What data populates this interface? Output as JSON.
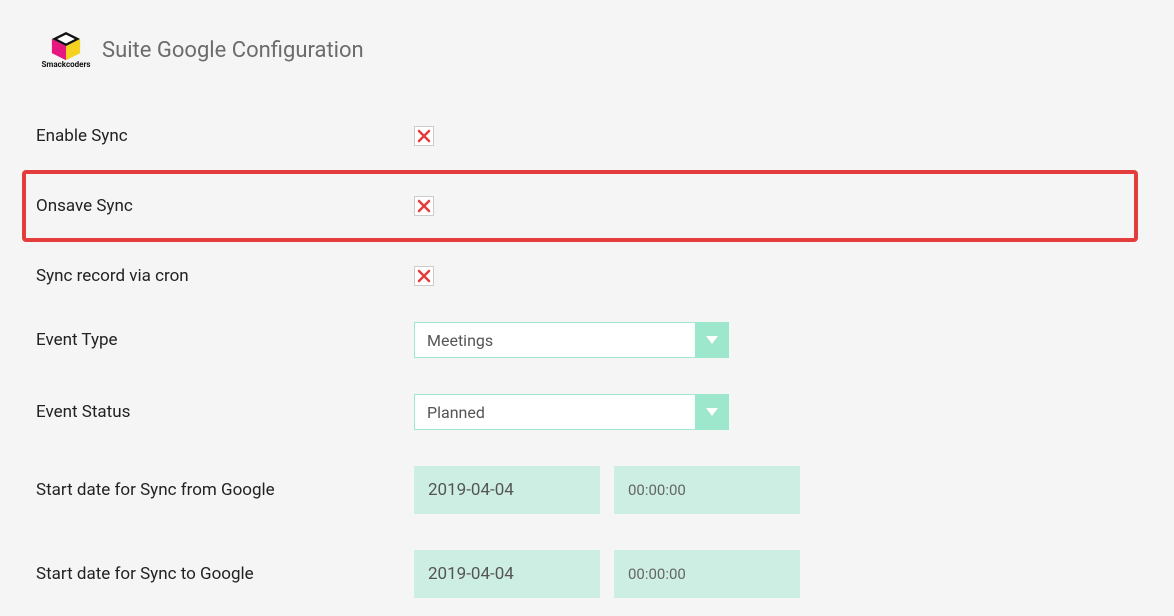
{
  "brand": {
    "name": "Smackcoders"
  },
  "page_title": "Suite Google Configuration",
  "rows": {
    "enable_sync": {
      "label": "Enable Sync",
      "checked": false
    },
    "onsave_sync": {
      "label": "Onsave Sync",
      "checked": false
    },
    "sync_cron": {
      "label": "Sync record via cron",
      "checked": false
    },
    "event_type": {
      "label": "Event Type",
      "value": "Meetings"
    },
    "event_status": {
      "label": "Event Status",
      "value": "Planned"
    },
    "start_from_google": {
      "label": "Start date for Sync from Google",
      "date": "2019-04-04",
      "time": "00:00:00"
    },
    "start_to_google": {
      "label": "Start date for Sync to Google",
      "date": "2019-04-04",
      "time": "00:00:00"
    }
  }
}
